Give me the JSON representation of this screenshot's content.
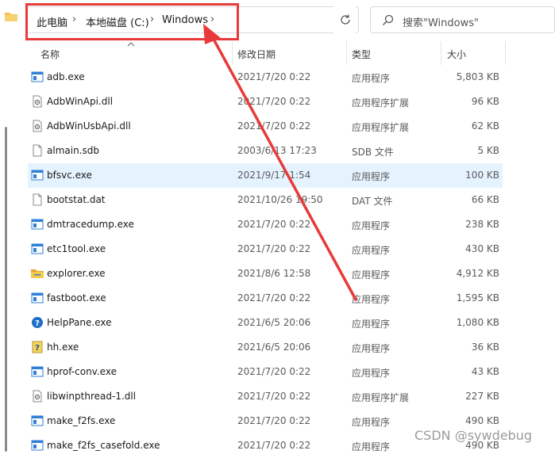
{
  "breadcrumb": {
    "items": [
      "此电脑",
      "本地磁盘 (C:)",
      "Windows"
    ],
    "separator": "›"
  },
  "search": {
    "placeholder": "搜索\"Windows\""
  },
  "columns": {
    "name": "名称",
    "date": "修改日期",
    "type": "类型",
    "size": "大小"
  },
  "files": [
    {
      "name": "adb.exe",
      "date": "2021/7/20 0:22",
      "type": "应用程序",
      "size": "5,803 KB",
      "icon": "exe-icon"
    },
    {
      "name": "AdbWinApi.dll",
      "date": "2021/7/20 0:22",
      "type": "应用程序扩展",
      "size": "96 KB",
      "icon": "dll-icon"
    },
    {
      "name": "AdbWinUsbApi.dll",
      "date": "2021/7/20 0:22",
      "type": "应用程序扩展",
      "size": "62 KB",
      "icon": "dll-icon"
    },
    {
      "name": "almain.sdb",
      "date": "2003/6/13 17:23",
      "type": "SDB 文件",
      "size": "5 KB",
      "icon": "file-icon"
    },
    {
      "name": "bfsvc.exe",
      "date": "2021/9/17 1:54",
      "type": "应用程序",
      "size": "100 KB",
      "icon": "exe-icon",
      "selected": true
    },
    {
      "name": "bootstat.dat",
      "date": "2021/10/26 19:50",
      "type": "DAT 文件",
      "size": "66 KB",
      "icon": "file-icon"
    },
    {
      "name": "dmtracedump.exe",
      "date": "2021/7/20 0:22",
      "type": "应用程序",
      "size": "238 KB",
      "icon": "exe-icon"
    },
    {
      "name": "etc1tool.exe",
      "date": "2021/7/20 0:22",
      "type": "应用程序",
      "size": "430 KB",
      "icon": "exe-icon"
    },
    {
      "name": "explorer.exe",
      "date": "2021/8/6 12:58",
      "type": "应用程序",
      "size": "4,912 KB",
      "icon": "explorer-icon"
    },
    {
      "name": "fastboot.exe",
      "date": "2021/7/20 0:22",
      "type": "应用程序",
      "size": "1,595 KB",
      "icon": "exe-icon"
    },
    {
      "name": "HelpPane.exe",
      "date": "2021/6/5 20:06",
      "type": "应用程序",
      "size": "1,080 KB",
      "icon": "help-icon"
    },
    {
      "name": "hh.exe",
      "date": "2021/6/5 20:06",
      "type": "应用程序",
      "size": "36 KB",
      "icon": "hh-icon"
    },
    {
      "name": "hprof-conv.exe",
      "date": "2021/7/20 0:22",
      "type": "应用程序",
      "size": "43 KB",
      "icon": "exe-icon"
    },
    {
      "name": "libwinpthread-1.dll",
      "date": "2021/7/20 0:22",
      "type": "应用程序扩展",
      "size": "227 KB",
      "icon": "dll-icon"
    },
    {
      "name": "make_f2fs.exe",
      "date": "2021/7/20 0:22",
      "type": "应用程序",
      "size": "490 KB",
      "icon": "exe-icon"
    },
    {
      "name": "make_f2fs_casefold.exe",
      "date": "2021/7/20 0:22",
      "type": "应用程序",
      "size": "490 KB",
      "icon": "exe-icon"
    }
  ],
  "watermark": "CSDN @sywdebug",
  "colors": {
    "annotation": "#e83a3a",
    "selection": "#e5f3ff",
    "exe_blue": "#2f7fd6",
    "folder": "#f2c14e"
  }
}
